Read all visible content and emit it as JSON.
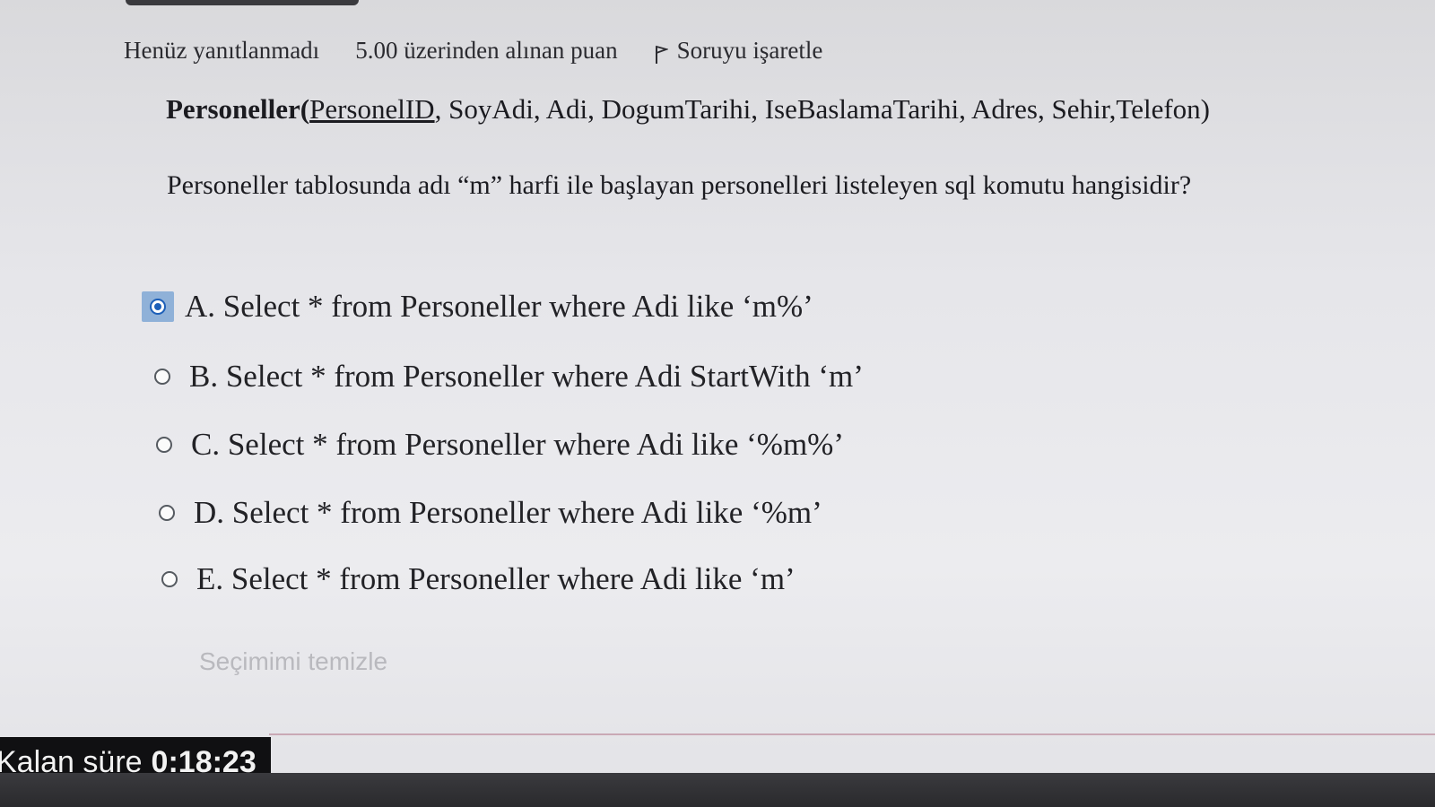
{
  "meta": {
    "status": "Henüz yanıtlanmadı",
    "points": "5.00 üzerinden alınan puan",
    "flag_label": "Soruyu işaretle"
  },
  "schema": {
    "table": "Personeller",
    "open": "(",
    "pk": "PersonelID",
    "rest": ", SoyAdi, Adi, DogumTarihi, IseBaslamaTarihi, Adres, Sehir,Telefon)"
  },
  "question": "Personeller tablosunda adı “m” harfi ile başlayan personelleri listeleyen sql komutu hangisidir?",
  "options": [
    {
      "label": "A. Select * from Personeller where Adi like ‘m%’",
      "selected": true
    },
    {
      "label": "B. Select * from Personeller where Adi StartWith ‘m’",
      "selected": false
    },
    {
      "label": "C. Select * from Personeller where Adi like ‘%m%’",
      "selected": false
    },
    {
      "label": "D. Select * from Personeller where Adi like ‘%m’",
      "selected": false
    },
    {
      "label": "E. Select * from Personeller where Adi like ‘m’",
      "selected": false
    }
  ],
  "clear_choice": "Seçimimi temizle",
  "timer": {
    "label": "Kalan süre",
    "value": "0:18:23"
  },
  "colors": {
    "accent": "#1c5fb8",
    "selected_bg": "#8fb1d8",
    "timer_bg": "#101012"
  }
}
